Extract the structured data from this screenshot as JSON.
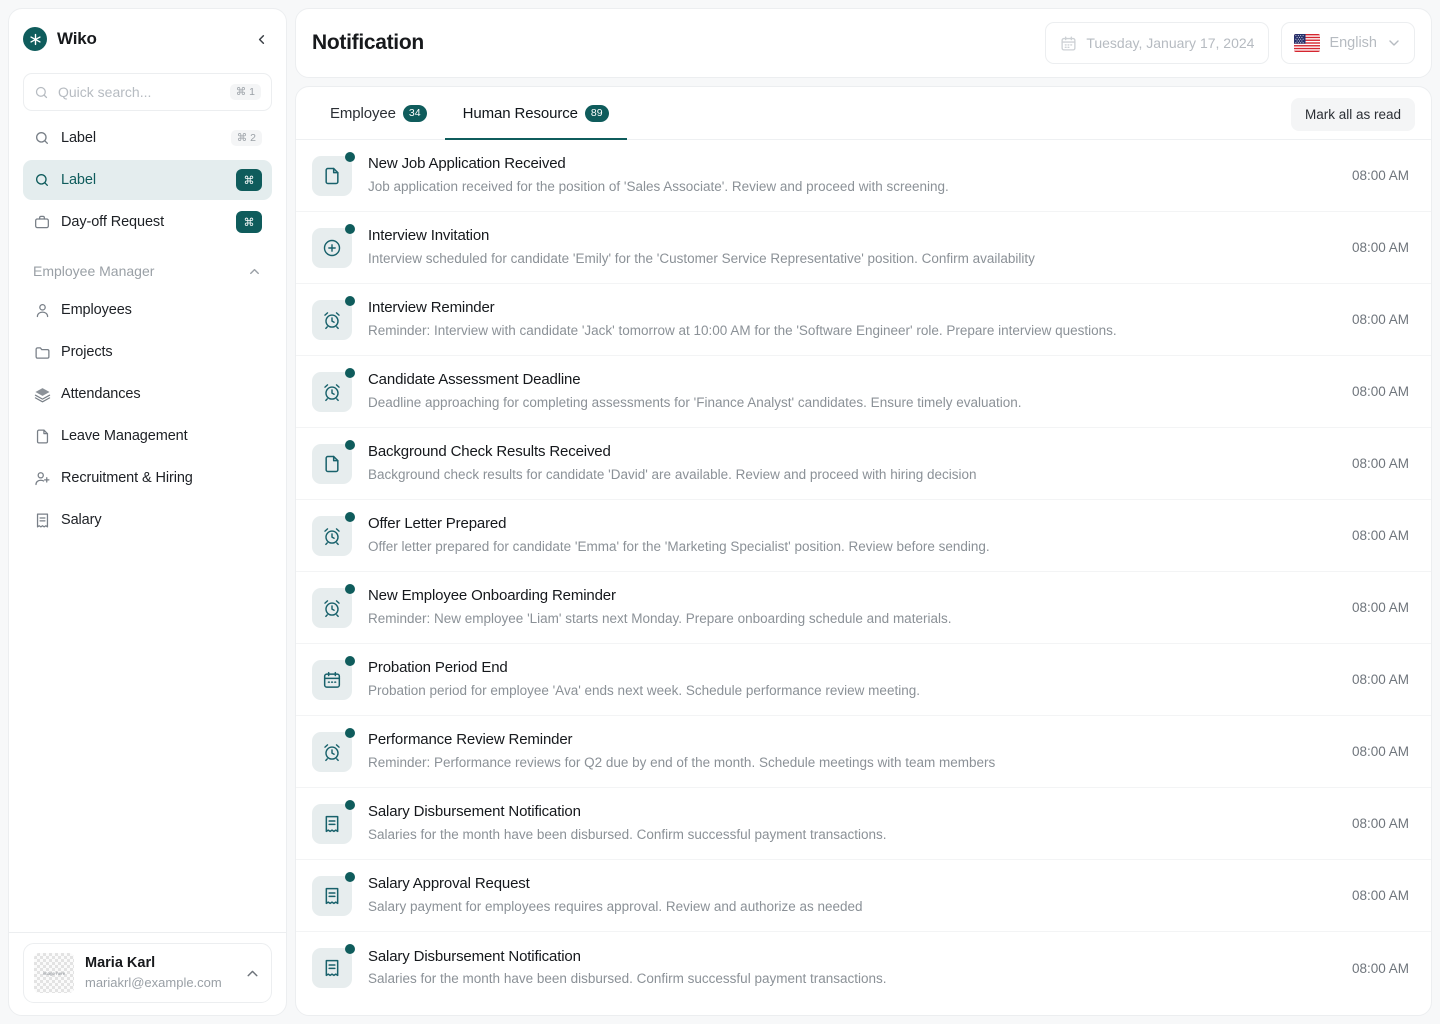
{
  "sidebar": {
    "brand": {
      "name": "Wiko",
      "logo_icon": "asterisk-icon"
    },
    "collapse_icon": "chevron-left-icon",
    "search": {
      "placeholder": "Quick search...",
      "shortcut": "⌘ 1",
      "icon": "search-icon"
    },
    "top_items": [
      {
        "label": "Label",
        "icon": "search-icon",
        "shortcut": "⌘ 2",
        "shortcut_style": "soft",
        "active": false
      },
      {
        "label": "Label",
        "icon": "search-icon",
        "shortcut": "⌘",
        "shortcut_style": "dark",
        "active": true
      },
      {
        "label": "Day-off Request",
        "icon": "briefcase-icon",
        "shortcut": "⌘",
        "shortcut_style": "dark",
        "active": false
      }
    ],
    "group": {
      "title": "Employee Manager",
      "chevron_icon": "chevron-up-icon"
    },
    "group_items": [
      {
        "label": "Employees",
        "icon": "user-icon"
      },
      {
        "label": "Projects",
        "icon": "folder-icon"
      },
      {
        "label": "Attendances",
        "icon": "layers-icon"
      },
      {
        "label": "Leave Management",
        "icon": "file-icon"
      },
      {
        "label": "Recruitment & Hiring",
        "icon": "user-plus-icon"
      },
      {
        "label": "Salary",
        "icon": "receipt-icon"
      }
    ],
    "profile": {
      "name": "Maria Karl",
      "email": "mariakrl@example.com",
      "avatar_placeholder": "image here",
      "chevron_icon": "chevron-up-icon"
    }
  },
  "header": {
    "title": "Notification",
    "date": {
      "value": "Tuesday, January 17, 2024",
      "icon": "calendar-icon"
    },
    "language": {
      "value": "English",
      "flag": "us-flag-icon",
      "chevron_icon": "chevron-down-icon"
    }
  },
  "panel": {
    "tabs": [
      {
        "label": "Employee",
        "count": "34",
        "active": false
      },
      {
        "label": "Human Resource",
        "count": "89",
        "active": true
      }
    ],
    "mark_all_label": "Mark all as read",
    "notifications": [
      {
        "icon": "file-icon",
        "title": "New Job Application Received",
        "desc": "Job application received for the position of 'Sales Associate'. Review and proceed with screening.",
        "time": "08:00 AM",
        "unread": true
      },
      {
        "icon": "plus-circle-icon",
        "title": "Interview Invitation",
        "desc": "Interview scheduled for candidate 'Emily' for the 'Customer Service Representative' position. Confirm availability",
        "time": "08:00 AM",
        "unread": true
      },
      {
        "icon": "alarm-icon",
        "title": "Interview Reminder",
        "desc": "Reminder: Interview with candidate 'Jack' tomorrow at 10:00 AM for the 'Software Engineer' role. Prepare interview questions.",
        "time": "08:00 AM",
        "unread": true
      },
      {
        "icon": "alarm-icon",
        "title": "Candidate Assessment Deadline",
        "desc": "Deadline approaching for completing assessments for 'Finance Analyst' candidates. Ensure timely evaluation.",
        "time": "08:00 AM",
        "unread": true
      },
      {
        "icon": "file-icon",
        "title": "Background Check Results Received",
        "desc": "Background check results for candidate 'David' are available. Review and proceed with hiring decision",
        "time": "08:00 AM",
        "unread": true
      },
      {
        "icon": "alarm-icon",
        "title": "Offer Letter Prepared",
        "desc": "Offer letter prepared for candidate 'Emma' for the 'Marketing Specialist' position. Review before sending.",
        "time": "08:00 AM",
        "unread": true
      },
      {
        "icon": "alarm-icon",
        "title": "New Employee Onboarding Reminder",
        "desc": "Reminder: New employee 'Liam' starts next Monday. Prepare onboarding schedule and materials.",
        "time": "08:00 AM",
        "unread": true
      },
      {
        "icon": "calendar-icon",
        "title": "Probation Period End",
        "desc": "Probation period for employee 'Ava' ends next week. Schedule performance review meeting.",
        "time": "08:00 AM",
        "unread": true
      },
      {
        "icon": "alarm-icon",
        "title": "Performance Review Reminder",
        "desc": "Reminder: Performance reviews for Q2 due by end of the month. Schedule meetings with team members",
        "time": "08:00 AM",
        "unread": true
      },
      {
        "icon": "receipt-icon",
        "title": "Salary Disbursement Notification",
        "desc": "Salaries for the month have been disbursed. Confirm successful payment transactions.",
        "time": "08:00 AM",
        "unread": true
      },
      {
        "icon": "receipt-icon",
        "title": "Salary Approval Request",
        "desc": "Salary payment for employees requires approval. Review and authorize as needed",
        "time": "08:00 AM",
        "unread": true
      },
      {
        "icon": "receipt-icon",
        "title": "Salary Disbursement Notification",
        "desc": "Salaries for the month have been disbursed. Confirm successful payment transactions.",
        "time": "08:00 AM",
        "unread": true
      }
    ]
  },
  "colors": {
    "accent": "#0f5c5c",
    "accent_soft": "#e4edee",
    "icon_box": "#e7edee",
    "border": "#eceef0",
    "page_bg": "#f7f8f9",
    "text": "#17191c",
    "muted": "#8b9197"
  }
}
